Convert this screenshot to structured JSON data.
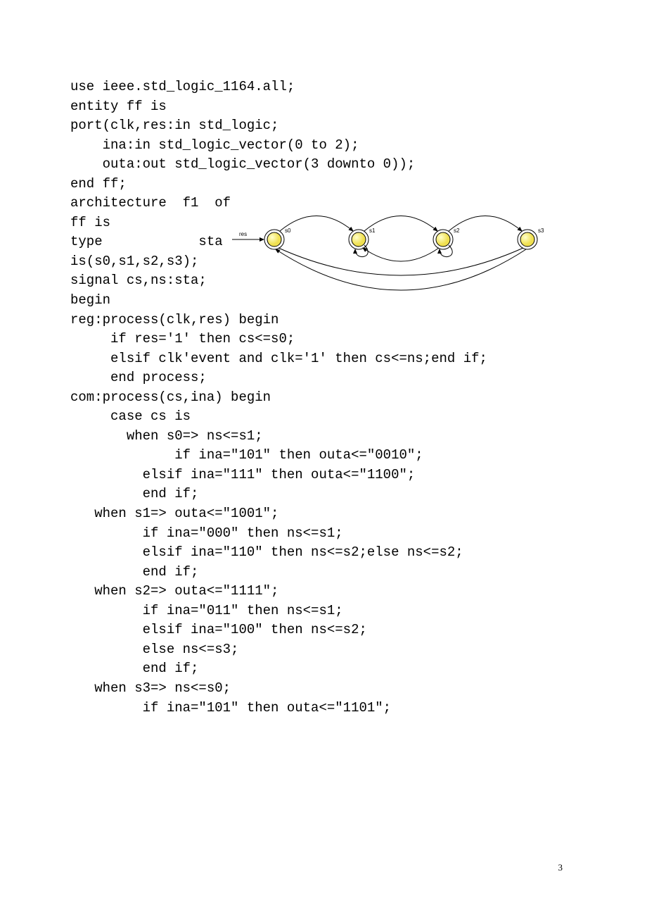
{
  "code": {
    "l1": "use ieee.std_logic_1164.all;",
    "l2": "entity ff is",
    "l3": "port(clk,res:in std_logic;",
    "l4": "    ina:in std_logic_vector(0 to 2);",
    "l5": "    outa:out std_logic_vector(3 downto 0));",
    "l6": "end ff;",
    "l7": "",
    "l8": "architecture f1 of ff is",
    "l9": "type sta is(s0,s1,s2,s3);",
    "l10": "signal cs,ns:sta;",
    "l11": "",
    "l12": "begin",
    "l13": "reg:process(clk,res) begin",
    "l14": "     if res='1' then cs<=s0;",
    "l15": "     elsif clk'event and clk='1' then cs<=ns;end if;",
    "l16": "     end process;",
    "l17": "com:process(cs,ina) begin",
    "l18": "     case cs is",
    "l19": "       when s0=> ns<=s1;",
    "l20": "             if ina=\"101\" then outa<=\"0010\";",
    "l21": "         elsif ina=\"111\" then outa<=\"1100\";",
    "l22": "         end if;",
    "l23": "   when s1=> outa<=\"1001\";",
    "l24": "         if ina=\"000\" then ns<=s1;",
    "l25": "         elsif ina=\"110\" then ns<=s2;else ns<=s2;",
    "l26": "         end if;",
    "l27": "   when s2=> outa<=\"1111\";",
    "l28": "         if ina=\"011\" then ns<=s1;",
    "l29": "         elsif ina=\"100\" then ns<=s2;",
    "l30": "         else ns<=s3;",
    "l31": "         end if;",
    "l32": "   when s3=> ns<=s0;",
    "l33": "         if ina=\"101\" then outa<=\"1101\";"
  },
  "diagram": {
    "res_label": "res",
    "states": [
      "s0",
      "s1",
      "s2",
      "s3"
    ]
  },
  "page_number": "3"
}
